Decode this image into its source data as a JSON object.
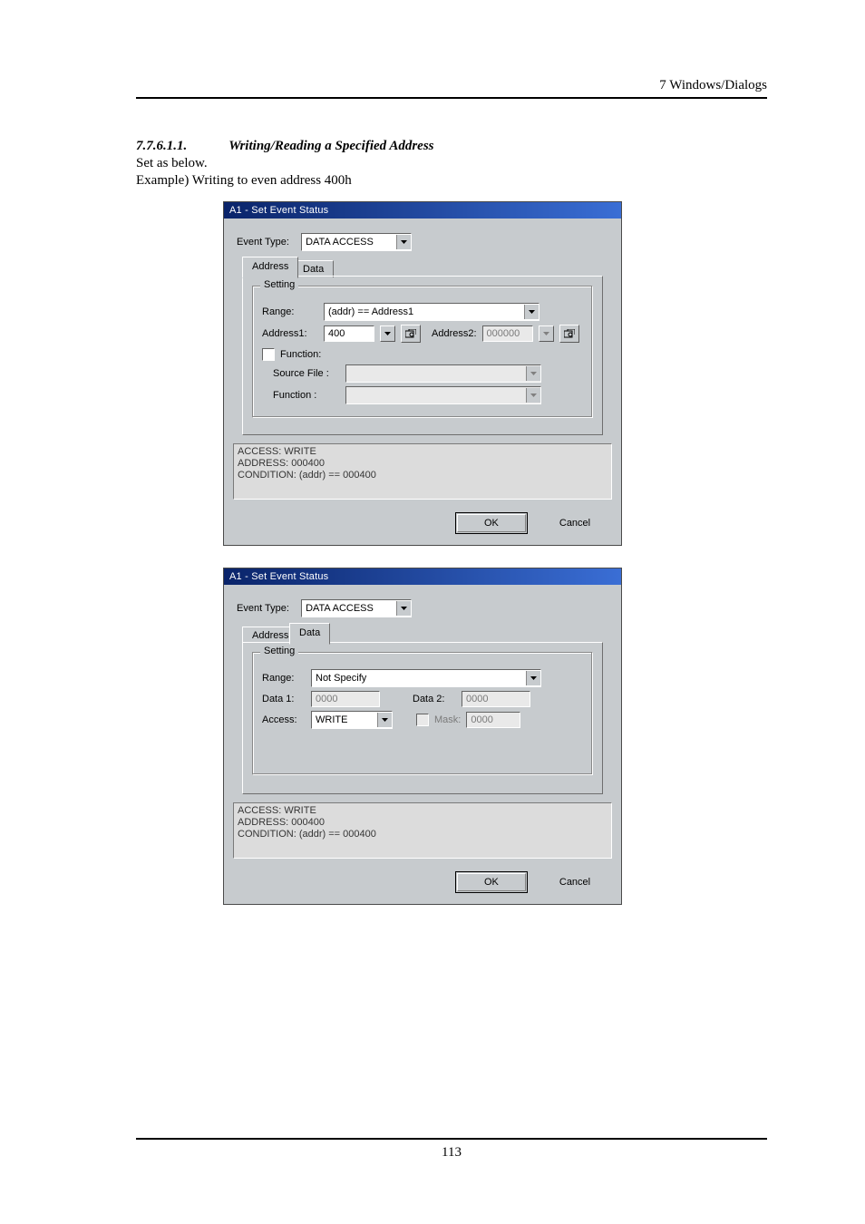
{
  "header": {
    "chapter": "7  Windows/Dialogs"
  },
  "section": {
    "number": "7.7.6.1.1.",
    "title": "Writing/Reading a Specified Address",
    "line1": "Set as below.",
    "line2": "Example) Writing to even address 400h"
  },
  "dialog1": {
    "title": "A1 - Set Event Status",
    "eventTypeLabel": "Event Type:",
    "eventType": "DATA ACCESS",
    "tabs": {
      "address": "Address",
      "data": "Data"
    },
    "groupLegend": "Setting",
    "address": {
      "rangeLabel": "Range:",
      "range": "(addr) == Address1",
      "addr1Label": "Address1:",
      "addr1": "400",
      "addr2Label": "Address2:",
      "addr2": "000000",
      "functionCheckLabel": "Function:",
      "srcLabel": "Source File :",
      "src": "",
      "funcLabel": "Function :",
      "func": ""
    },
    "status": "ACCESS: WRITE\nADDRESS: 000400\nCONDITION: (addr) == 000400",
    "ok": "OK",
    "cancel": "Cancel"
  },
  "dialog2": {
    "title": "A1 - Set Event Status",
    "eventTypeLabel": "Event Type:",
    "eventType": "DATA ACCESS",
    "tabs": {
      "address": "Address",
      "data": "Data"
    },
    "groupLegend": "Setting",
    "data": {
      "rangeLabel": "Range:",
      "range": "Not Specify",
      "d1Label": "Data 1:",
      "d1": "0000",
      "d2Label": "Data 2:",
      "d2": "0000",
      "accessLabel": "Access:",
      "access": "WRITE",
      "maskLabel": "Mask:",
      "mask": "0000"
    },
    "status": "ACCESS: WRITE\nADDRESS: 000400\nCONDITION: (addr) == 000400",
    "ok": "OK",
    "cancel": "Cancel"
  },
  "footer": {
    "page": "113"
  }
}
